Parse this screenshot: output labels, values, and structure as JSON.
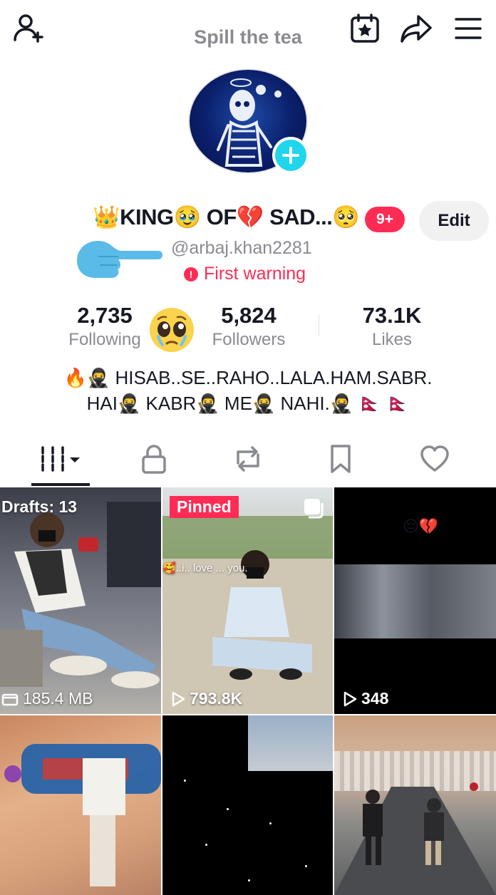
{
  "header": {
    "spill_text": "Spill the tea"
  },
  "profile": {
    "display_name": "👑KING🥹 OF💔 SAD...🥺",
    "notifications": "9+",
    "edit_label": "Edit",
    "username": "@arbaj.khan2281",
    "warning": "First warning"
  },
  "stats": {
    "following_count": "2,735",
    "following_label": "Following",
    "followers_count": "5,824",
    "followers_label": "Followers",
    "likes_count": "73.1K",
    "likes_label": "Likes"
  },
  "bio": {
    "line1": "🔥🥷 HISAB..SE..RAHO..LALA.HAM.SABR.",
    "line2": "HAI🥷 KABR🥷 ME🥷 NAHI.🥷 🇳🇵 🇳🇵"
  },
  "tabs": [
    "videos",
    "private",
    "reposts",
    "favorites",
    "liked"
  ],
  "grid": {
    "tile1": {
      "drafts": "Drafts: 13",
      "size": "185.4 MB"
    },
    "tile2": {
      "pinned": "Pinned",
      "caption": "🥰..i.. love ... you.",
      "views": "793.8K"
    },
    "tile3": {
      "emoji": "😔💔",
      "views": "348"
    }
  },
  "colors": {
    "accent": "#fe2c55",
    "teal": "#20d5ec",
    "muted_text": "#8a8b91"
  }
}
